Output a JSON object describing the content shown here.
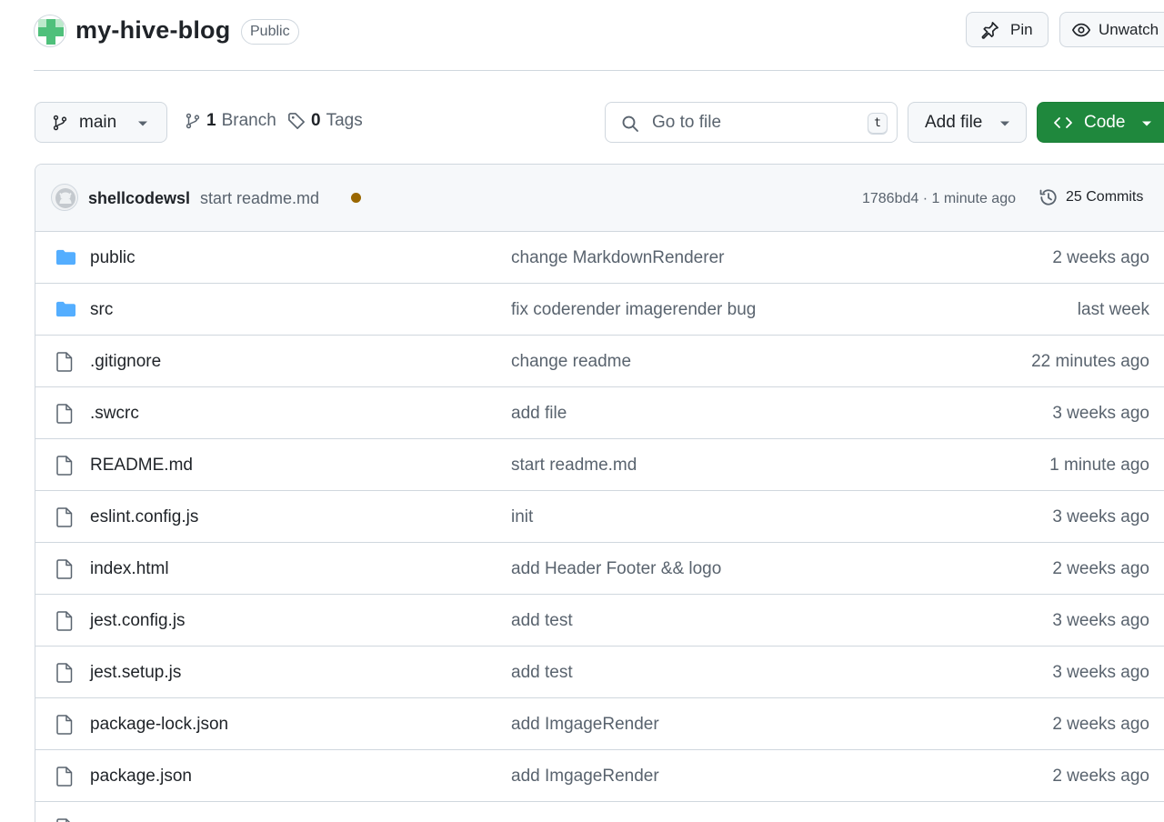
{
  "repo": {
    "name": "my-hive-blog",
    "visibility": "Public",
    "pin_label": "Pin",
    "watch_label": "Unwatch"
  },
  "toolbar": {
    "branch": "main",
    "branch_count": "1",
    "branch_word": "Branch",
    "tag_count": "0",
    "tag_word": "Tags",
    "search_placeholder": "Go to file",
    "search_shortcut": "t",
    "add_file_label": "Add file",
    "code_label": "Code"
  },
  "latest_commit": {
    "author": "shellcodewsl",
    "message": "start readme.md",
    "status_color": "#9a6700",
    "hash_time": "1786bd4 · 1 minute ago",
    "commits_label": "25 Commits"
  },
  "files": [
    {
      "type": "dir",
      "name": "public",
      "message": "change MarkdownRenderer",
      "date": "2 weeks ago"
    },
    {
      "type": "dir",
      "name": "src",
      "message": "fix coderender imagerender bug",
      "date": "last week"
    },
    {
      "type": "file",
      "name": ".gitignore",
      "message": "change readme",
      "date": "22 minutes ago"
    },
    {
      "type": "file",
      "name": ".swcrc",
      "message": "add file",
      "date": "3 weeks ago"
    },
    {
      "type": "file",
      "name": "README.md",
      "message": "start readme.md",
      "date": "1 minute ago"
    },
    {
      "type": "file",
      "name": "eslint.config.js",
      "message": "init",
      "date": "3 weeks ago"
    },
    {
      "type": "file",
      "name": "index.html",
      "message": "add Header Footer && logo",
      "date": "2 weeks ago"
    },
    {
      "type": "file",
      "name": "jest.config.js",
      "message": "add test",
      "date": "3 weeks ago"
    },
    {
      "type": "file",
      "name": "jest.setup.js",
      "message": "add test",
      "date": "3 weeks ago"
    },
    {
      "type": "file",
      "name": "package-lock.json",
      "message": "add ImgageRender",
      "date": "2 weeks ago"
    },
    {
      "type": "file",
      "name": "package.json",
      "message": "add ImgageRender",
      "date": "2 weeks ago"
    },
    {
      "type": "file",
      "name": "",
      "message": "",
      "date": ""
    }
  ],
  "colors": {
    "accent_green": "#1f883d",
    "folder_blue": "#54aeff",
    "border": "#d0d7de",
    "muted_text": "#59636e"
  }
}
